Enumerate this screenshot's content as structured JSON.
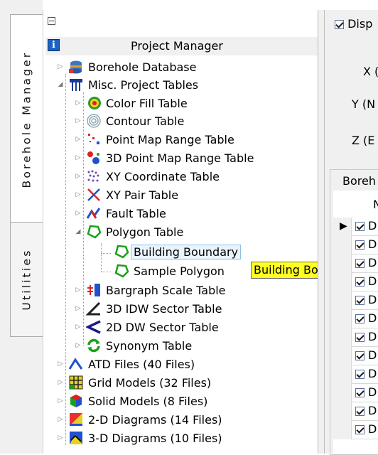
{
  "tabs": {
    "borehole_manager": "Borehole Manager",
    "utilities": "Utilities"
  },
  "tree": {
    "root": "Project Manager",
    "items": [
      {
        "label": "Borehole Database",
        "icon": "borehole-database-icon"
      },
      {
        "label": "Misc. Project Tables",
        "icon": "misc-tables-icon"
      },
      {
        "label": "Color Fill Table",
        "icon": "color-fill-icon"
      },
      {
        "label": "Contour Table",
        "icon": "contour-icon"
      },
      {
        "label": "Point Map Range Table",
        "icon": "point-map-icon"
      },
      {
        "label": "3D Point Map Range Table",
        "icon": "point-map-3d-icon"
      },
      {
        "label": "XY Coordinate Table",
        "icon": "xy-coordinate-icon"
      },
      {
        "label": "XY Pair Table",
        "icon": "xy-pair-icon"
      },
      {
        "label": "Fault Table",
        "icon": "fault-icon"
      },
      {
        "label": "Polygon Table",
        "icon": "polygon-icon"
      },
      {
        "label": "Building Boundary",
        "icon": "polygon-icon"
      },
      {
        "label": "Sample Polygon",
        "icon": "polygon-icon"
      },
      {
        "label": "Bargraph Scale Table",
        "icon": "bargraph-icon"
      },
      {
        "label": "3D IDW Sector Table",
        "icon": "idw-sector-icon"
      },
      {
        "label": "2D DW Sector Table",
        "icon": "dw-sector-icon"
      },
      {
        "label": "Synonym Table",
        "icon": "synonym-icon"
      },
      {
        "label": "ATD Files (40 Files)",
        "icon": "atd-files-icon"
      },
      {
        "label": "Grid Models (32 Files)",
        "icon": "grid-models-icon"
      },
      {
        "label": "Solid Models (8 Files)",
        "icon": "solid-models-icon"
      },
      {
        "label": "2-D Diagrams (14 Files)",
        "icon": "diagrams-2d-icon"
      },
      {
        "label": "3-D Diagrams (10 Files)",
        "icon": "diagrams-3d-icon"
      }
    ]
  },
  "tooltip": "Building Boundary",
  "right_panel": {
    "display_checkbox_label": "Disp",
    "x_label": "X (",
    "y_label": "Y (N",
    "z_label": "Z (E",
    "group_label": "Boreh",
    "column_header": "N",
    "row_cell_text": "D"
  },
  "colors": {
    "tooltip": "#ffff22",
    "selection_border": "#8fc2ea",
    "panel_bg": "#f0f0f0"
  }
}
